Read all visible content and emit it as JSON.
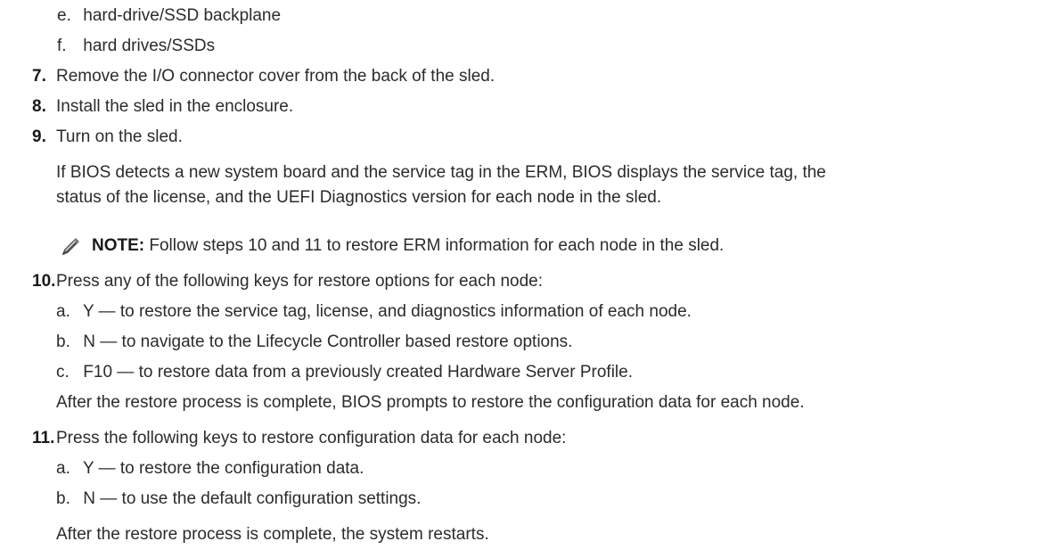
{
  "substeps_top": [
    {
      "marker": "e.",
      "text": "hard-drive/SSD backplane"
    },
    {
      "marker": "f.",
      "text": "hard drives/SSDs"
    }
  ],
  "steps": {
    "s7": {
      "num": "7.",
      "text": "Remove the I/O connector cover from the back of the sled."
    },
    "s8": {
      "num": "8.",
      "text": "Install the sled in the enclosure."
    },
    "s9": {
      "num": "9.",
      "text": "Turn on the sled.",
      "para_line1": "If BIOS detects a new system board and the service tag in the ERM, BIOS displays the service tag, the",
      "para_line2": "status of the license, and the UEFI Diagnostics version for each node in the sled.",
      "note_label": "NOTE:",
      "note_text": " Follow steps 10 and 11 to restore ERM information for each node in the sled."
    },
    "s10": {
      "num": "10.",
      "text": "Press any of the following keys for restore options for each node:",
      "subs": [
        {
          "marker": "a.",
          "text": "Y — to restore the service tag, license, and diagnostics information of each node."
        },
        {
          "marker": "b.",
          "text": "N — to navigate to the Lifecycle Controller based restore options."
        },
        {
          "marker": "c.",
          "text": "F10 — to restore data from a previously created Hardware Server Profile."
        }
      ],
      "after": "After the restore process is complete, BIOS prompts to restore the configuration data for each node."
    },
    "s11": {
      "num": "11.",
      "text": "Press the following keys to restore configuration data for each node:",
      "subs": [
        {
          "marker": "a.",
          "text": "Y — to restore the configuration data."
        },
        {
          "marker": "b.",
          "text": "N — to use the default configuration settings."
        }
      ],
      "after": "After the restore process is complete, the system restarts."
    }
  }
}
